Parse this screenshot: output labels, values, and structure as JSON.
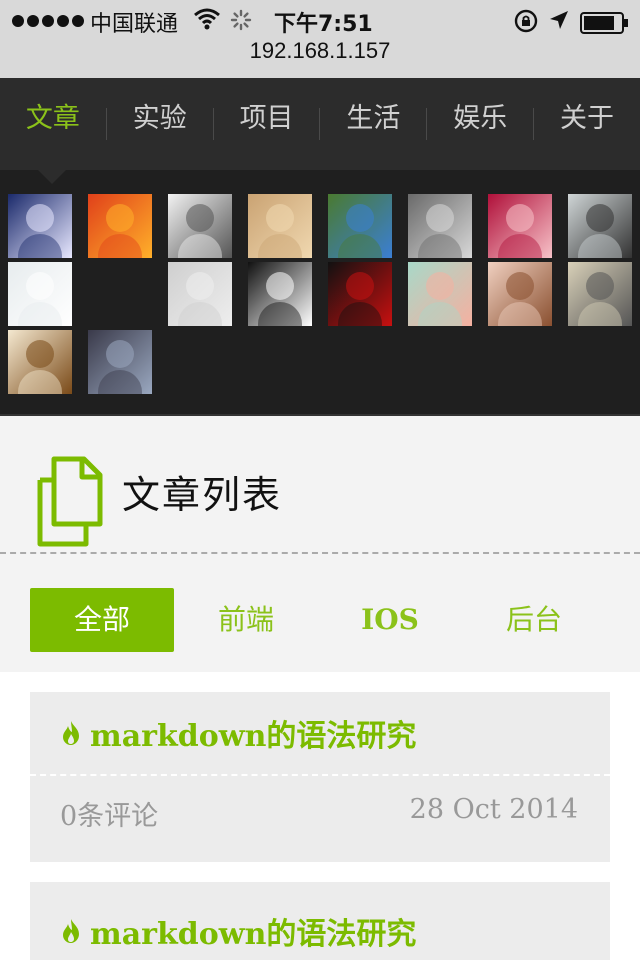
{
  "status_bar": {
    "carrier": "中国联通",
    "time": "下午7:51",
    "url": "192.168.1.157"
  },
  "nav": {
    "items": [
      {
        "label": "文章",
        "active": true
      },
      {
        "label": "实验",
        "active": false
      },
      {
        "label": "项目",
        "active": false
      },
      {
        "label": "生活",
        "active": false
      },
      {
        "label": "娱乐",
        "active": false
      },
      {
        "label": "关于",
        "active": false
      }
    ]
  },
  "avatars": [
    {
      "name": "avatar-singer-icon",
      "colors": [
        "#1b2a6b",
        "#e8e8ff"
      ]
    },
    {
      "name": "avatar-sunset-icon",
      "colors": [
        "#e0401a",
        "#ffb02a"
      ]
    },
    {
      "name": "avatar-standing-figure-icon",
      "colors": [
        "#f2f2f2",
        "#555555"
      ]
    },
    {
      "name": "avatar-child-icon",
      "colors": [
        "#caa373",
        "#f0d8b0"
      ]
    },
    {
      "name": "avatar-boy-blue-icon",
      "colors": [
        "#4a7a30",
        "#3b7fd4"
      ]
    },
    {
      "name": "avatar-bed-icon",
      "colors": [
        "#6a6a6a",
        "#d8d8d8"
      ]
    },
    {
      "name": "avatar-anime-girls-icon",
      "colors": [
        "#b0103a",
        "#f7c2c8"
      ]
    },
    {
      "name": "avatar-skateboard-icon",
      "colors": [
        "#cfd5d6",
        "#333333"
      ]
    },
    {
      "name": "avatar-default-icon",
      "colors": [
        "#e7ecee",
        "#ffffff"
      ]
    },
    {
      "name": "avatar-blank-icon",
      "colors": [
        "#1f1f1f",
        "#1f1f1f"
      ]
    },
    {
      "name": "avatar-sketch-icon",
      "colors": [
        "#cfcfcf",
        "#eeeeee"
      ]
    },
    {
      "name": "avatar-smiley-face-icon",
      "colors": [
        "#111111",
        "#ffffff"
      ]
    },
    {
      "name": "avatar-v-logo-icon",
      "colors": [
        "#111111",
        "#c81010"
      ]
    },
    {
      "name": "avatar-flowers-icon",
      "colors": [
        "#a8d8c8",
        "#f5b0a0"
      ]
    },
    {
      "name": "avatar-girl-portrait-icon",
      "colors": [
        "#f0d0c0",
        "#8a5030"
      ]
    },
    {
      "name": "avatar-cartoon-man-icon",
      "colors": [
        "#d8d0b8",
        "#555555"
      ]
    },
    {
      "name": "avatar-cartoon-dog-icon",
      "colors": [
        "#f4e8d0",
        "#7a4a18"
      ]
    },
    {
      "name": "avatar-lying-person-icon",
      "colors": [
        "#3a3a4a",
        "#9aa8c0"
      ]
    }
  ],
  "section": {
    "title": "文章列表"
  },
  "filters": [
    {
      "label": "全部",
      "active": true
    },
    {
      "label": "前端",
      "active": false
    },
    {
      "label": "IOS",
      "active": false
    },
    {
      "label": "后台",
      "active": false
    }
  ],
  "articles": [
    {
      "title": "markdown的语法研究",
      "comments": "0条评论",
      "date": "28 Oct 2014"
    },
    {
      "title": "markdown的语法研究",
      "comments": "",
      "date": ""
    }
  ],
  "colors": {
    "accent": "#7cbb00",
    "nav_bg": "#2c2c2c",
    "panel_bg": "#1f1f1f"
  }
}
